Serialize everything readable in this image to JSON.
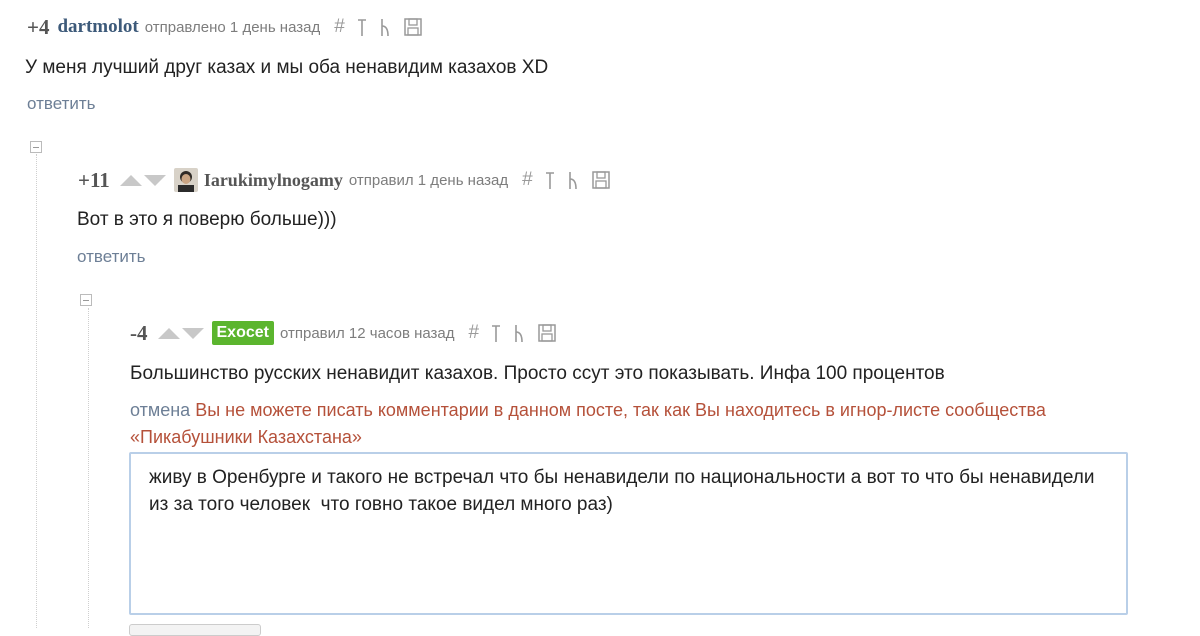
{
  "comment1": {
    "score": "+4",
    "username": "dartmolot",
    "meta": "отправлено 1 день назад",
    "tools": {
      "link": "#",
      "parent": "↑",
      "tree": "⋮",
      "save": "save"
    },
    "text": "У меня лучший друг казах и мы оба ненавидим казахов XD",
    "reply_label": "ответить"
  },
  "comment2": {
    "score": "+11",
    "username": "Iarukimylnogamy",
    "meta": "отправил 1 день назад",
    "text": "Вот в это я поверю больше)))",
    "reply_label": "ответить"
  },
  "comment3": {
    "score": "-4",
    "username": "Exocet",
    "meta": "отправил 12 часов назад",
    "text": "Большинство русских ненавидит казахов. Просто ссут это показывать. Инфа 100 процентов",
    "cancel_label": "отмена",
    "notice": "Вы не можете писать комментарии в данном посте, так как Вы находитесь в игнор-листе сообщества «Пикабушники Казахстана»"
  },
  "reply_box": {
    "value": "живу в Оренбурге и такого не встречал что бы ненавидели по национальности а вот то что бы ненавидели из за того человек  что говно такое видел много раз)"
  },
  "colors": {
    "username": "#3d5a7a",
    "badge": "#5bb52e",
    "notice": "#b5513a",
    "link": "#6d7f96",
    "editor_border": "#b9cfe8"
  }
}
